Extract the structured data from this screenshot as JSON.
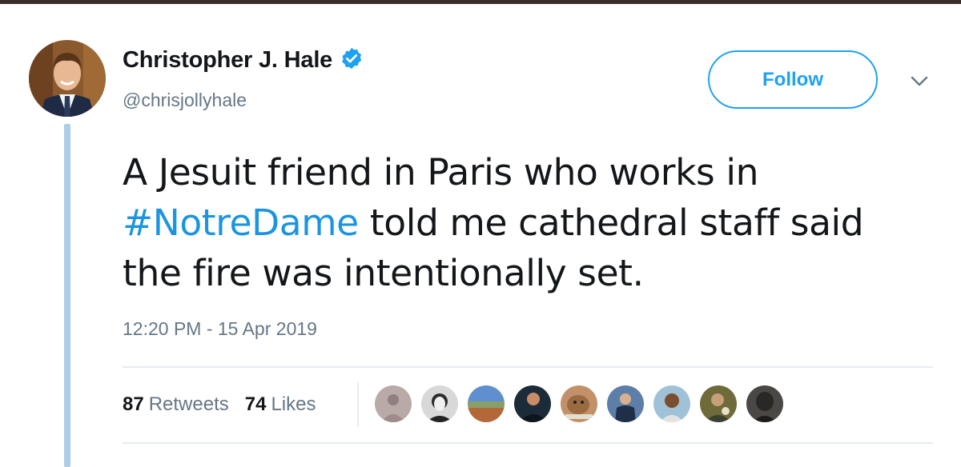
{
  "user": {
    "display_name": "Christopher J. Hale",
    "handle": "@chrisjollyhale"
  },
  "follow_button_label": "Follow",
  "tweet": {
    "text_lines": [
      "A Jesuit friend in Paris who works in",
      "told me cathedral staff said",
      "the fire was intentionally set."
    ],
    "hashtag": "#NotreDame",
    "timestamp": "12:20 PM - 15 Apr 2019"
  },
  "stats": {
    "retweets_count": "87",
    "retweets_label": "Retweets",
    "likes_count": "74",
    "likes_label": "Likes"
  },
  "colors": {
    "accent": "#1da1f2",
    "hashtag": "#1b95e0",
    "secondary_text": "#657786",
    "thread_line": "#aacde8"
  },
  "icons": [
    "verified-badge-icon",
    "chevron-down-icon"
  ]
}
